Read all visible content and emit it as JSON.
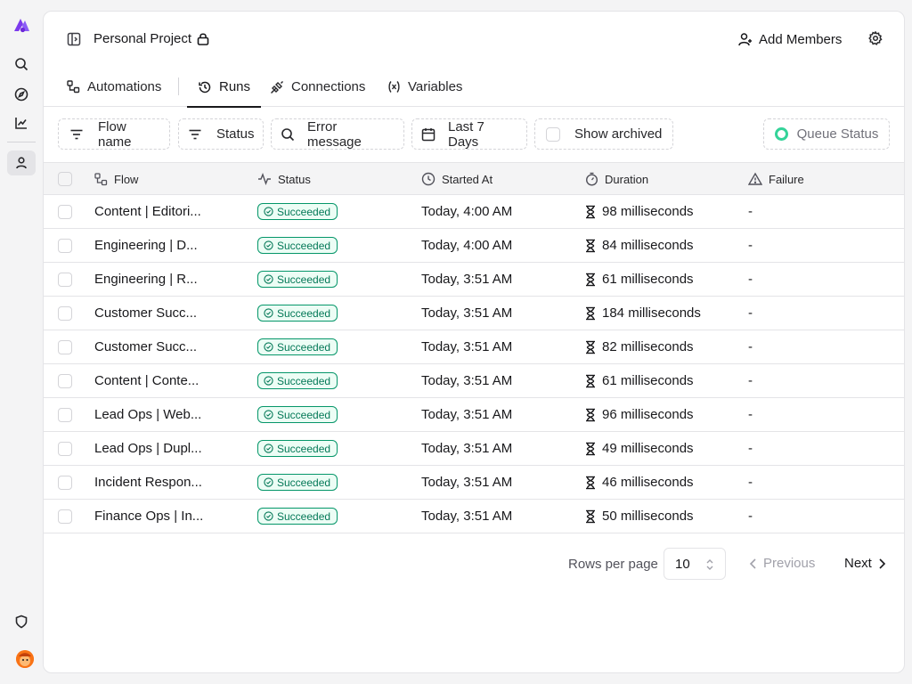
{
  "project": {
    "title": "Personal Project"
  },
  "header": {
    "add_members_label": "Add Members"
  },
  "tabs": [
    {
      "label": "Automations"
    },
    {
      "label": "Runs"
    },
    {
      "label": "Connections"
    },
    {
      "label": "Variables"
    }
  ],
  "filters": {
    "flow_name": "Flow name",
    "status": "Status",
    "error_message": "Error message",
    "date_range": "Last 7 Days",
    "show_archived": "Show archived",
    "queue_status": "Queue Status"
  },
  "table": {
    "columns": [
      "Flow",
      "Status",
      "Started At",
      "Duration",
      "Failure"
    ],
    "rows": [
      {
        "flow": "Content | Editori...",
        "status": "Succeeded",
        "started": "Today, 4:00 AM",
        "duration": "98 milliseconds",
        "failure": "-"
      },
      {
        "flow": "Engineering | D...",
        "status": "Succeeded",
        "started": "Today, 4:00 AM",
        "duration": "84 milliseconds",
        "failure": "-"
      },
      {
        "flow": "Engineering | R...",
        "status": "Succeeded",
        "started": "Today, 3:51 AM",
        "duration": "61 milliseconds",
        "failure": "-"
      },
      {
        "flow": "Customer Succ...",
        "status": "Succeeded",
        "started": "Today, 3:51 AM",
        "duration": "184 milliseconds",
        "failure": "-"
      },
      {
        "flow": "Customer Succ...",
        "status": "Succeeded",
        "started": "Today, 3:51 AM",
        "duration": "82 milliseconds",
        "failure": "-"
      },
      {
        "flow": "Content | Conte...",
        "status": "Succeeded",
        "started": "Today, 3:51 AM",
        "duration": "61 milliseconds",
        "failure": "-"
      },
      {
        "flow": "Lead Ops | Web...",
        "status": "Succeeded",
        "started": "Today, 3:51 AM",
        "duration": "96 milliseconds",
        "failure": "-"
      },
      {
        "flow": "Lead Ops | Dupl...",
        "status": "Succeeded",
        "started": "Today, 3:51 AM",
        "duration": "49 milliseconds",
        "failure": "-"
      },
      {
        "flow": "Incident Respon...",
        "status": "Succeeded",
        "started": "Today, 3:51 AM",
        "duration": "46 milliseconds",
        "failure": "-"
      },
      {
        "flow": "Finance Ops | In...",
        "status": "Succeeded",
        "started": "Today, 3:51 AM",
        "duration": "50 milliseconds",
        "failure": "-"
      }
    ]
  },
  "pagination": {
    "rows_per_page_label": "Rows per page",
    "rows_per_page_value": "10",
    "previous_label": "Previous",
    "next_label": "Next"
  },
  "colors": {
    "brand": "#7c3aed",
    "success_border": "#059669",
    "success_bg": "#ecfdf5",
    "queue_ok": "#34d399"
  }
}
